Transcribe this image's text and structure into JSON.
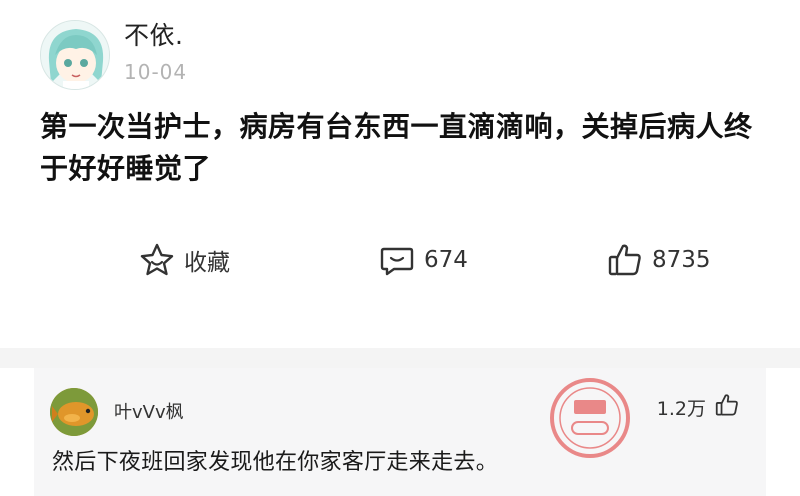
{
  "post": {
    "username": "不依.",
    "date": "10-04",
    "content": "第一次当护士，病房有台东西一直滴滴响，关掉后病人终于好好睡觉了",
    "actions": {
      "favorite_label": "收藏",
      "comment_count": "674",
      "like_count": "8735"
    }
  },
  "comment": {
    "username": "叶vVv枫",
    "like_count": "1.2万",
    "text": "然后下夜班回家发现他在你家客厅走来走去。"
  },
  "colors": {
    "divider": "#f4f4f4",
    "comment_bg": "#f6f6f7",
    "stamp_red": "#e0302e"
  },
  "icons": [
    "star-icon",
    "comment-bubble-icon",
    "thumbs-up-icon",
    "avatar-anime-girl",
    "avatar-goldfish",
    "watermark-stamp"
  ]
}
